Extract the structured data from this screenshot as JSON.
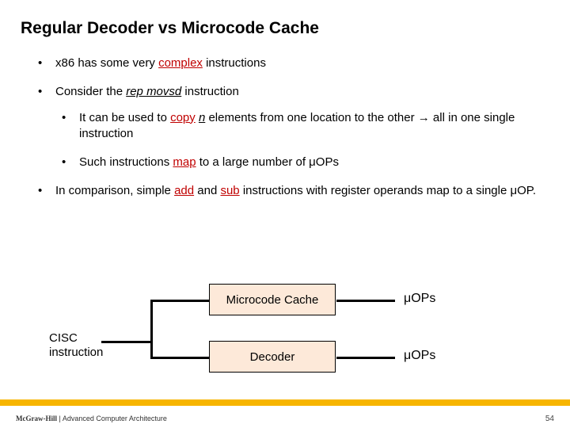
{
  "title": "Regular Decoder vs Microcode Cache",
  "bullets": {
    "b1_pre": "x86 has some very ",
    "b1_red": "complex",
    "b1_post": " instructions",
    "b2_pre": "Consider the ",
    "b2_ital": "rep movsd",
    "b2_post": " instruction",
    "b2a_pre": "It can be used to ",
    "b2a_red": "copy",
    "b2a_mid": " ",
    "b2a_ital": "n",
    "b2a_post": " elements from one location to the other → all in one single instruction",
    "b2b_pre": "Such instructions ",
    "b2b_red": "map",
    "b2b_post": " to a large number of μOPs",
    "b3_pre": "In comparison, simple ",
    "b3_red1": "add",
    "b3_mid": " and ",
    "b3_red2": "sub",
    "b3_post": " instructions with register operands map to a single μOP."
  },
  "diagram": {
    "source": "CISC\ninstruction",
    "box_cache": "Microcode Cache",
    "box_decoder": "Decoder",
    "out1": "μOPs",
    "out2": "μOPs"
  },
  "footer": {
    "publisher": "McGraw-Hill",
    "subtitle": " | Advanced Computer Architecture",
    "page": "54"
  }
}
